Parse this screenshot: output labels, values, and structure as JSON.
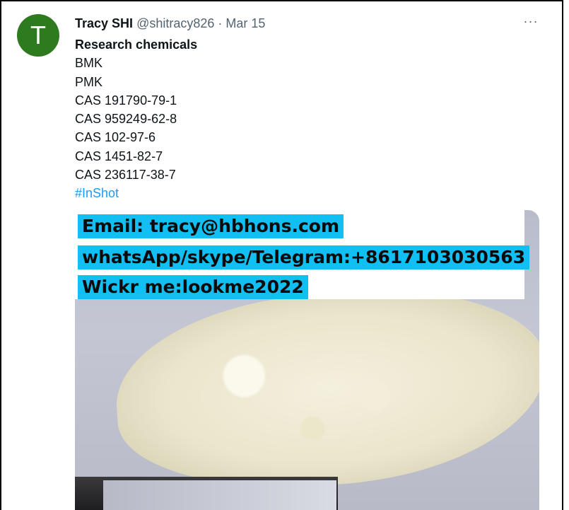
{
  "tweet": {
    "avatar_letter": "T",
    "author_name": "Tracy SHI",
    "handle": "@shitracy826",
    "separator": "·",
    "date": "Mar 15",
    "more_label": "···",
    "lines": [
      "Research chemicals",
      "BMK",
      "PMK",
      "CAS 191790-79-1",
      "CAS 959249-62-8",
      "CAS 102-97-6",
      "CAS 1451-82-7",
      "CAS 236117-38-7"
    ],
    "hashtag": "#InShot"
  },
  "media": {
    "overlay_lines": [
      "Email:  tracy@hbhons.com",
      "whatsApp/skype/Telegram:+8617103030563",
      "Wickr me:lookme2022"
    ]
  },
  "colors": {
    "avatar_bg": "#2e7a1e",
    "hashtag": "#1d9bf0",
    "highlight": "#11bff2",
    "muted": "#536471"
  }
}
